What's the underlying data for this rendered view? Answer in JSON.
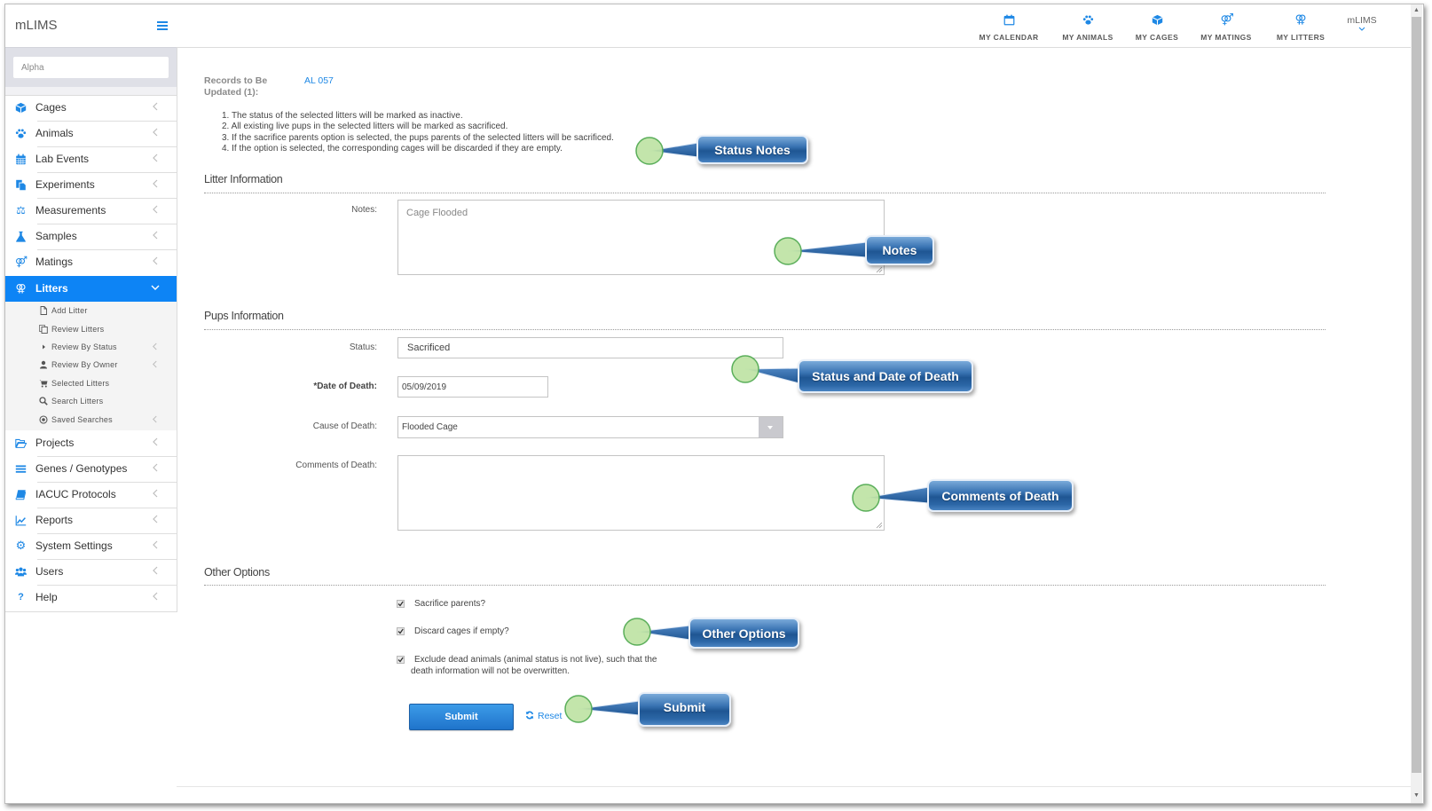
{
  "app": {
    "title": "mLIMS"
  },
  "sidebar": {
    "search": {
      "placeholder": "Alpha",
      "value": ""
    },
    "items": [
      {
        "label": "Cages",
        "icon": "cube-icon"
      },
      {
        "label": "Animals",
        "icon": "paw-icon"
      },
      {
        "label": "Lab Events",
        "icon": "calendar-icon"
      },
      {
        "label": "Experiments",
        "icon": "files-icon"
      },
      {
        "label": "Measurements",
        "icon": "balance-scale-icon"
      },
      {
        "label": "Samples",
        "icon": "flask-icon"
      },
      {
        "label": "Matings",
        "icon": "mars-venus-icon"
      },
      {
        "label": "Litters",
        "icon": "venus-double-icon",
        "active": true
      },
      {
        "label": "Projects",
        "icon": "folder-open-icon"
      },
      {
        "label": "Genes / Genotypes",
        "icon": "bars-icon"
      },
      {
        "label": "IACUC Protocols",
        "icon": "book-icon"
      },
      {
        "label": "Reports",
        "icon": "line-chart-icon"
      },
      {
        "label": "System Settings",
        "icon": "gear-icon"
      },
      {
        "label": "Users",
        "icon": "users-icon"
      },
      {
        "label": "Help",
        "icon": "question-icon"
      }
    ],
    "litters_submenu": [
      {
        "label": "Add Litter",
        "icon": "file-icon"
      },
      {
        "label": "Review Litters",
        "icon": "copy-icon"
      },
      {
        "label": "Review By Status",
        "icon": "caret-right-icon"
      },
      {
        "label": "Review By Owner",
        "icon": "user-icon"
      },
      {
        "label": "Selected Litters",
        "icon": "cart-icon"
      },
      {
        "label": "Search Litters",
        "icon": "search-icon"
      },
      {
        "label": "Saved Searches",
        "icon": "dot-circle-icon"
      }
    ]
  },
  "topnav": {
    "items": [
      {
        "label": "MY CALENDAR",
        "icon": "calendar-icon"
      },
      {
        "label": "MY ANIMALS",
        "icon": "paw-icon"
      },
      {
        "label": "MY CAGES",
        "icon": "cube-icon"
      },
      {
        "label": "MY MATINGS",
        "icon": "mars-venus-icon"
      },
      {
        "label": "MY LITTERS",
        "icon": "venus-double-icon"
      }
    ],
    "user": "mLIMS"
  },
  "content": {
    "records": {
      "label_line1": "Records to Be",
      "label_line2": "Updated (1):",
      "value": "AL 057"
    },
    "status_notes": [
      "1. The status of the selected litters will be marked as inactive.",
      "2. All existing live pups in the selected litters will be marked as sacrificed.",
      "3. If the sacrifice parents option is selected, the pups parents of the selected litters will be sacrificed.",
      "4. If the option is selected, the corresponding cages will be discarded if they are empty."
    ],
    "litter_info": {
      "heading": "Litter Information",
      "notes_label": "Notes:",
      "notes_value": "Cage Flooded"
    },
    "pups_info": {
      "heading": "Pups Information",
      "status_label": "Status:",
      "status_value": "Sacrificed",
      "date_label": "*Date of Death:",
      "date_value": "05/09/2019",
      "cause_label": "Cause of Death:",
      "cause_value": "Flooded Cage",
      "comments_label": "Comments of Death:",
      "comments_value": ""
    },
    "other_options": {
      "heading": "Other Options",
      "options": [
        {
          "label": "Sacrifice parents?",
          "checked": true
        },
        {
          "label": "Discard cages if empty?",
          "checked": true
        },
        {
          "label": "Exclude dead animals (animal status is not live), such that the death information will not be overwritten.",
          "checked": true
        }
      ]
    },
    "actions": {
      "submit": "Submit",
      "reset": "Reset"
    }
  },
  "callouts": [
    "Status Notes",
    "Notes",
    "Status and Date of Death",
    "Comments of Death",
    "Other Options",
    "Submit"
  ],
  "colors": {
    "accent": "#1e88e5",
    "active_nav": "#0d84f5",
    "callout_blue": "#1f5693",
    "callout_marker": "#bfe3a8"
  }
}
